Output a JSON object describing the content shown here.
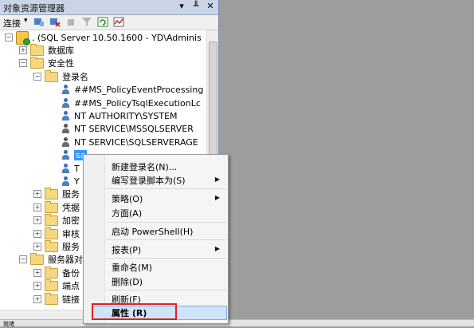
{
  "panel": {
    "title": "对象资源管理器",
    "pin": "▾ ╨ ✕"
  },
  "toolbar": {
    "connect_label": "连接",
    "caret": "▾"
  },
  "tree": {
    "server": ". (SQL Server 10.50.1600 - YD\\Adminis",
    "databases": "数据库",
    "security": "安全性",
    "logins": "登录名",
    "login_items": [
      "##MS_PolicyEventProcessing",
      "##MS_PolicyTsqlExecutionLc",
      "NT AUTHORITY\\SYSTEM",
      "NT SERVICE\\MSSQLSERVER",
      "NT SERVICE\\SQLSERVERAGE",
      "sa",
      "T",
      "Y"
    ],
    "security_others": [
      "服务",
      "凭据",
      "加密",
      "审核",
      "服务"
    ],
    "server_objects": "服务器对",
    "server_object_items": [
      "备份",
      "端点",
      "链接"
    ]
  },
  "context_menu": {
    "items": [
      {
        "label": "新建登录名(N)..."
      },
      {
        "label": "编写登录脚本为(S)"
      },
      {
        "label": "策略(O)"
      },
      {
        "label": "方面(A)"
      },
      {
        "label": "启动 PowerShell(H)"
      },
      {
        "label": "报表(P)"
      },
      {
        "label": "重命名(M)"
      },
      {
        "label": "删除(D)"
      },
      {
        "label": "刷新(F)"
      },
      {
        "label": "属性 (R)"
      }
    ],
    "submenu_arrow": "▶"
  },
  "status": {
    "text": "就绪"
  }
}
